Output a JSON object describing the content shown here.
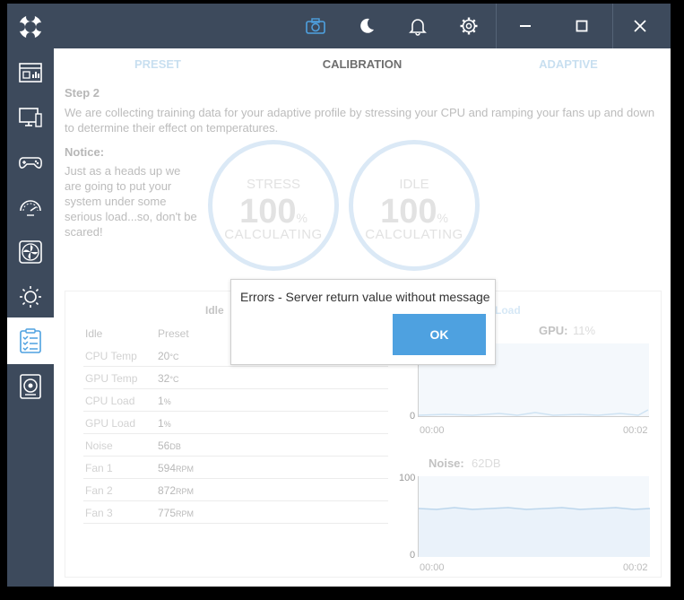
{
  "colors": {
    "sidebar": "#3d4a5c",
    "accent": "#4ea1e0",
    "faded_blue": "#c8dff0"
  },
  "topbar": {
    "icons": [
      "camera-icon",
      "moon-icon",
      "bell-icon",
      "gear-icon",
      "minimize-icon",
      "maximize-icon",
      "close-icon"
    ]
  },
  "sidebar": {
    "items": [
      "dashboard-icon",
      "monitor-icon",
      "gamepad-icon",
      "speedometer-icon",
      "fan-icon",
      "sun-icon",
      "checklist-icon",
      "speaker-icon"
    ],
    "active": "checklist-icon"
  },
  "tabs": {
    "preset": "PRESET",
    "calibration": "CALIBRATION",
    "adaptive": "ADAPTIVE"
  },
  "step": {
    "title": "Step 2",
    "description": "We are collecting training data for your adaptive profile by stressing your CPU and ramping your fans up and down to determine their effect on temperatures."
  },
  "notice": {
    "title": "Notice:",
    "text": "Just as a heads up we are going to put your system under some serious load...so, don't be scared!"
  },
  "gauges": {
    "stress": {
      "label": "STRESS",
      "value": "100",
      "unit": "%",
      "status": "CALCULATING"
    },
    "idle": {
      "label": "IDLE",
      "value": "100",
      "unit": "%",
      "status": "CALCULATING"
    }
  },
  "panel": {
    "idle_header": "Idle",
    "load_header": "Load",
    "table": {
      "headers": [
        "Idle",
        "Preset"
      ],
      "rows": [
        {
          "name": "CPU Temp",
          "value": "20",
          "unit": "°C"
        },
        {
          "name": "GPU Temp",
          "value": "32",
          "unit": "°C"
        },
        {
          "name": "CPU Load",
          "value": "1",
          "unit": "%"
        },
        {
          "name": "GPU Load",
          "value": "1",
          "unit": "%"
        },
        {
          "name": "Noise",
          "value": "56",
          "unit": "DB"
        },
        {
          "name": "Fan 1",
          "value": "594",
          "unit": "RPM"
        },
        {
          "name": "Fan 2",
          "value": "872",
          "unit": "RPM"
        },
        {
          "name": "Fan 3",
          "value": "775",
          "unit": "RPM"
        }
      ]
    },
    "gpu_chart": {
      "title": "GPU:",
      "value": "11%",
      "y_min": "0",
      "x_start": "00:00",
      "x_end": "00:02"
    },
    "noise_chart": {
      "title": "Noise:",
      "value": "62DB",
      "y_max": "100",
      "y_min": "0",
      "x_start": "00:00",
      "x_end": "00:02"
    }
  },
  "dialog": {
    "message": "Errors - Server return value without message",
    "ok_label": "OK"
  }
}
